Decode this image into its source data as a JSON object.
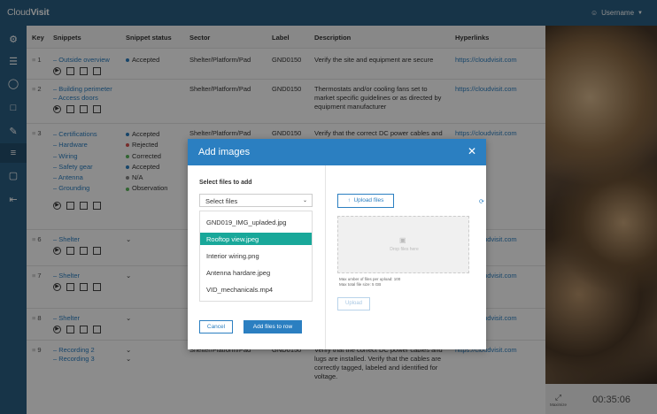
{
  "app": {
    "logo_prefix": "Cloud",
    "logo_suffix": "Visit",
    "user": "Username"
  },
  "table": {
    "headers": [
      "Key",
      "Snippets",
      "Snippet status",
      "Sector",
      "Label",
      "Description",
      "Hyperlinks"
    ],
    "rows": [
      {
        "key": "1",
        "snippets": [
          "Outside overview"
        ],
        "statuses": [
          "Accepted"
        ],
        "sector": "Shelter/Platform/Pad",
        "label": "GND0150",
        "description": "Verify the site and equipment are secure",
        "hyperlink": "https://cloudvisit.com"
      },
      {
        "key": "2",
        "snippets": [
          "Building perimeter",
          "Access doors"
        ],
        "statuses": [],
        "sector": "Shelter/Platform/Pad",
        "label": "GND0150",
        "description": "Thermostats and/or cooling fans set to market specific guidelines or as directed by equipment manufacturer",
        "hyperlink": "https://cloudvisit.com"
      },
      {
        "key": "3",
        "snippets": [
          "Certifications",
          "Hardware",
          "Wiring",
          "Safety gear",
          "Antenna",
          "Grounding"
        ],
        "statuses": [
          "Accepted",
          "Rejected",
          "Corrected",
          "Accepted",
          "N/A",
          "Observation"
        ],
        "sector": "Shelter/Platform/Pad",
        "label": "GND0150",
        "description": "Verify that the correct DC power cables and lugs are installed. Verify that the cables",
        "hyperlink": "https://cloudvisit.com"
      },
      {
        "key": "6",
        "snippets": [
          "Shelter"
        ],
        "statuses": [],
        "hyperlink": "https://cloudvisit.com"
      },
      {
        "key": "7",
        "snippets": [
          "Shelter"
        ],
        "statuses": [],
        "hyperlink": "https://cloudvisit.com"
      },
      {
        "key": "8",
        "snippets": [
          "Shelter"
        ],
        "statuses": [],
        "hyperlink": "https://cloudvisit.com"
      },
      {
        "key": "9",
        "snippets": [
          "Recording 2",
          "Recording 3"
        ],
        "statuses": [],
        "sector": "Shelter/Platform/Pad",
        "label": "GND0150",
        "description": "Verify that the correct DC power cables and lugs are installed. Verify that the cables are correctly tagged, labeled and identified for voltage.",
        "hyperlink": "https://cloudvisit.com"
      }
    ]
  },
  "status_colors": {
    "Accepted": "#2b7fc1",
    "Rejected": "#d9534f",
    "Corrected": "#5cb85c",
    "N/A": "#888888",
    "Observation": "#5cb85c"
  },
  "video": {
    "maximize_label": "Maximize",
    "timer": "00:35:06"
  },
  "modal": {
    "title": "Add images",
    "select_label": "Select files to add",
    "select_value": "Select files",
    "files": [
      "GND019_IMG_upladed.jpg",
      "Rooftop view.jpeg",
      "Interior wiring.png",
      "Antenna hardare.jpeg",
      "VID_mechanicals.mp4"
    ],
    "selected_file": "Rooftop view.jpeg",
    "cancel": "Cancel",
    "add": "Add files to row",
    "upload_files": "Upload files",
    "drop_text": "Drop files here",
    "limit_files": "Max umber of files per upload: 100",
    "limit_size": "Max total file size: 5 GB",
    "upload": "Upload"
  }
}
